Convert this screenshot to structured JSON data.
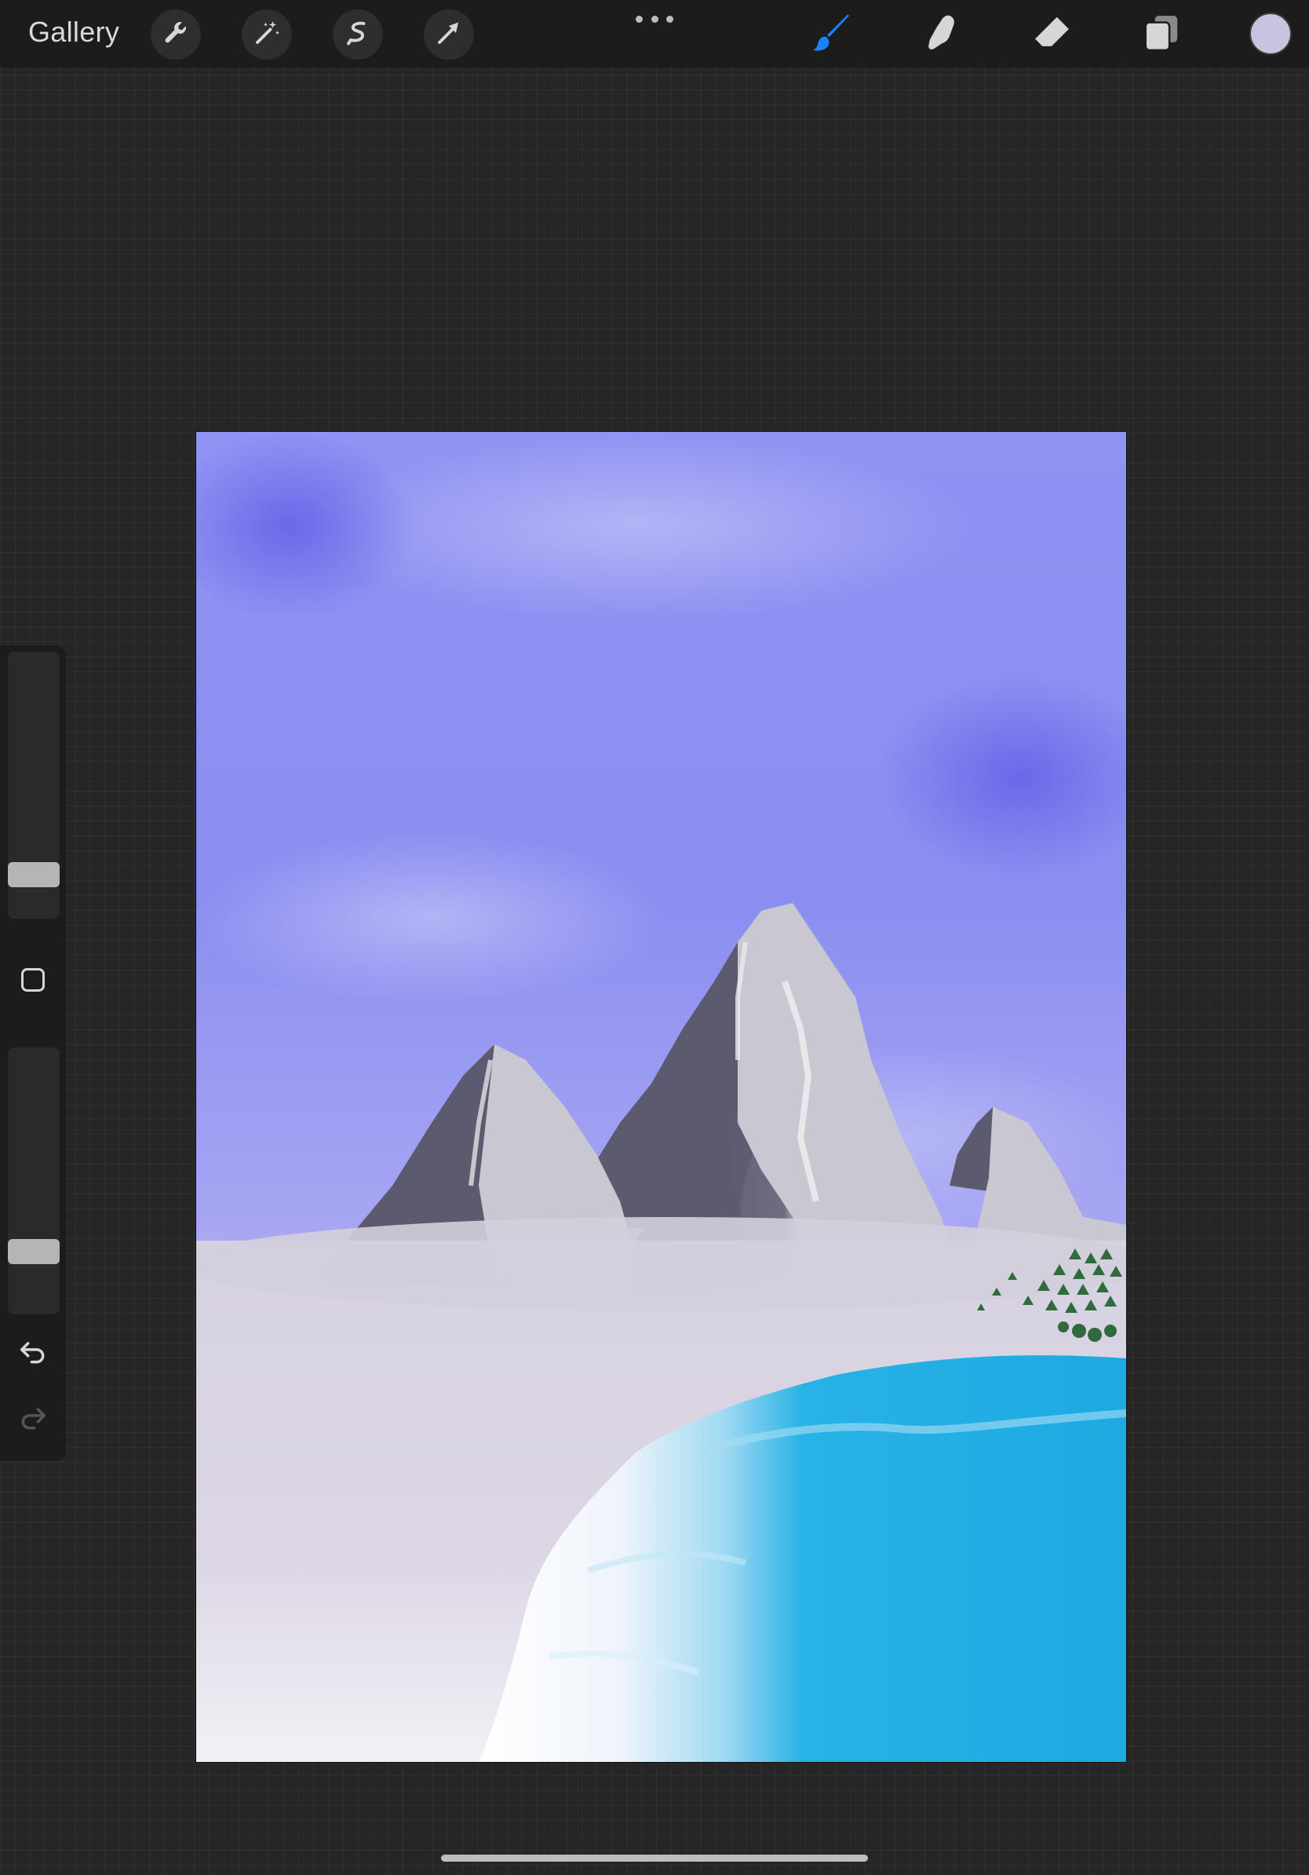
{
  "topbar": {
    "gallery_label": "Gallery",
    "left_tools": [
      {
        "name": "actions",
        "icon": "wrench-icon"
      },
      {
        "name": "adjustments",
        "icon": "magic-wand-icon"
      },
      {
        "name": "selection",
        "icon": "selection-s-icon"
      },
      {
        "name": "transform",
        "icon": "arrow-cursor-icon"
      }
    ],
    "more_menu_icon": "ellipsis-icon",
    "right_tools": [
      {
        "name": "brush",
        "icon": "brush-icon",
        "active": true,
        "color": "#1a82ff"
      },
      {
        "name": "smudge",
        "icon": "smudge-finger-icon"
      },
      {
        "name": "eraser",
        "icon": "eraser-icon"
      },
      {
        "name": "layers",
        "icon": "layers-icon"
      }
    ],
    "current_color": "#c9c3e0"
  },
  "sidebar": {
    "brush_size_level": 0.12,
    "opacity_level": 0.2,
    "modify_button_icon": "square-outline-icon",
    "undo_icon": "undo-arrow-icon",
    "redo_icon": "redo-arrow-icon"
  },
  "canvas": {
    "subject": "painting-mountains-sea",
    "colors": {
      "sky_top": "#8f93f2",
      "sky_bottom": "#c8c4f2",
      "mountain_shadow": "#5c5a6e",
      "mountain_light": "#c9c8d1",
      "mist": "#d8d3e0",
      "sea": "#1ea9e2",
      "shore": "#ffffff"
    }
  }
}
